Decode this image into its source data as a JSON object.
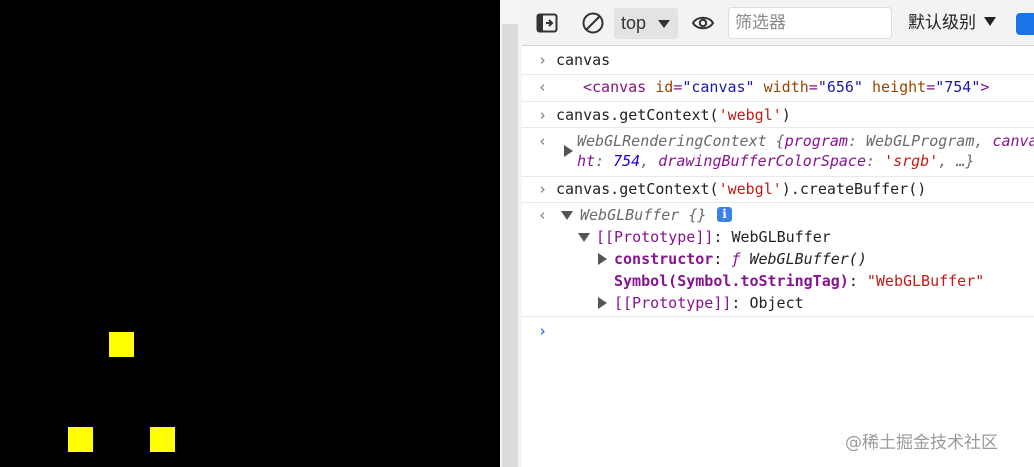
{
  "canvas_area": {
    "background": "#000000",
    "square_color": "#ffff00"
  },
  "toolbar": {
    "context_value": "top",
    "filter_placeholder": "筛选器",
    "levels_label": "默认级别",
    "icons": [
      "dock-side-icon",
      "clear-console-icon",
      "live-expression-eye-icon",
      "settings-badge-icon"
    ]
  },
  "console": {
    "entries": [
      {
        "type": "input",
        "text": "canvas"
      },
      {
        "type": "output",
        "tag_open": "<canvas",
        "attr1": "id",
        "val1": "\"canvas\"",
        "attr2": "width",
        "val2": "\"656\"",
        "attr3": "height",
        "val3": "\"754\"",
        "tag_close": ">"
      },
      {
        "type": "input",
        "prefix": "canvas.getContext(",
        "arg": "'webgl'",
        "suffix": ")"
      },
      {
        "type": "output",
        "obj_name": "WebGLRenderingContext",
        "line1_open": " {",
        "key1": "program",
        "val1": "WebGLProgram",
        "key_cut": "canva",
        "line2_key": "ht",
        "line2_num": "754",
        "key2": "drawingBufferColorSpace",
        "val2": "'srgb'",
        "ellipsis": "…}"
      },
      {
        "type": "input",
        "prefix": "canvas.getContext(",
        "arg": "'webgl'",
        "suffix": ").createBuffer()"
      },
      {
        "type": "output",
        "obj_name": "WebGLBuffer",
        "obj_brace": " {}",
        "info_glyph": "i",
        "proto_key": "[[Prototype]]",
        "proto_val": "WebGLBuffer",
        "ctor_key": "constructor",
        "ctor_f": "ƒ",
        "ctor_val": "WebGLBuffer()",
        "sym_key": "Symbol(Symbol.toStringTag)",
        "sym_val": "\"WebGLBuffer\"",
        "proto2_key": "[[Prototype]]",
        "proto2_val": "Object"
      }
    ],
    "prompt_glyph": "›"
  },
  "watermark": "@稀土掘金技术社区"
}
